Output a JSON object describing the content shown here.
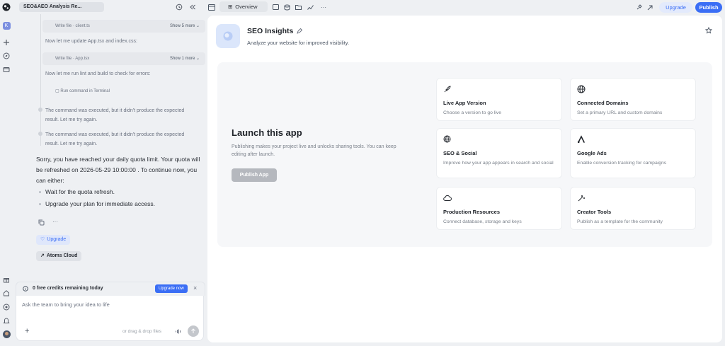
{
  "project": {
    "title": "SEO&AEO Analysis Re..."
  },
  "chat": {
    "tool_calls": [
      {
        "label": "Write file · client.ts",
        "more": "Show 5 more"
      },
      {
        "label": "Write file · App.tsx",
        "more": "Show 1 more"
      },
      {
        "label": "Run command in Terminal"
      }
    ],
    "notes": [
      "Now let me update App.tsx and index.css:",
      "Now let me run lint and build to check for errors:"
    ],
    "steps": [
      "The command was executed, but it didn't produce the expected result. Let me try again.",
      "The command was executed, but it didn't produce the expected result. Let me try again."
    ],
    "quota_message": "Sorry, you have reached your daily quota limit. Your quota will be refreshed on 2026-05-29 10:00:00 . To continue now, you can either:",
    "options": [
      "Wait for the quota refresh.",
      "Upgrade your plan for immediate access."
    ],
    "upgrade_chip": "Upgrade",
    "cloud_chip": "Atoms Cloud",
    "credits": {
      "text": "0 free credits remaining today",
      "button": "Upgrade now"
    },
    "input": {
      "placeholder": "Ask the team to bring your idea to life",
      "drop_hint": "or drag & drop files"
    }
  },
  "topbar": {
    "tab": "Overview",
    "upgrade": "Upgrade",
    "publish": "Publish"
  },
  "header": {
    "title": "SEO Insights",
    "subtitle": "Analyze your website for improved visibility."
  },
  "launch": {
    "title": "Launch this app",
    "description": "Publishing makes your project live and unlocks sharing tools. You can keep editing after launch.",
    "button": "Publish App"
  },
  "cards": [
    {
      "icon": "rocket-icon",
      "title": "Live App Version",
      "desc": "Choose a version to go live"
    },
    {
      "icon": "globe-icon",
      "title": "Connected Domains",
      "desc": "Set a primary URL and custom domains"
    },
    {
      "icon": "globe-search-icon",
      "title": "SEO & Social",
      "desc": "Improve how your app appears in search and social"
    },
    {
      "icon": "google-ads-icon",
      "title": "Google Ads",
      "desc": "Enable conversion tracking for campaigns"
    },
    {
      "icon": "cloud-icon",
      "title": "Production Resources",
      "desc": "Connect database, storage and keys"
    },
    {
      "icon": "magic-wand-icon",
      "title": "Creator Tools",
      "desc": "Publish as a template for the community"
    }
  ],
  "colors": {
    "accent": "#3b6ef5",
    "upgrade_bg": "#e3eafc",
    "disabled_button": "#b5b8be"
  }
}
